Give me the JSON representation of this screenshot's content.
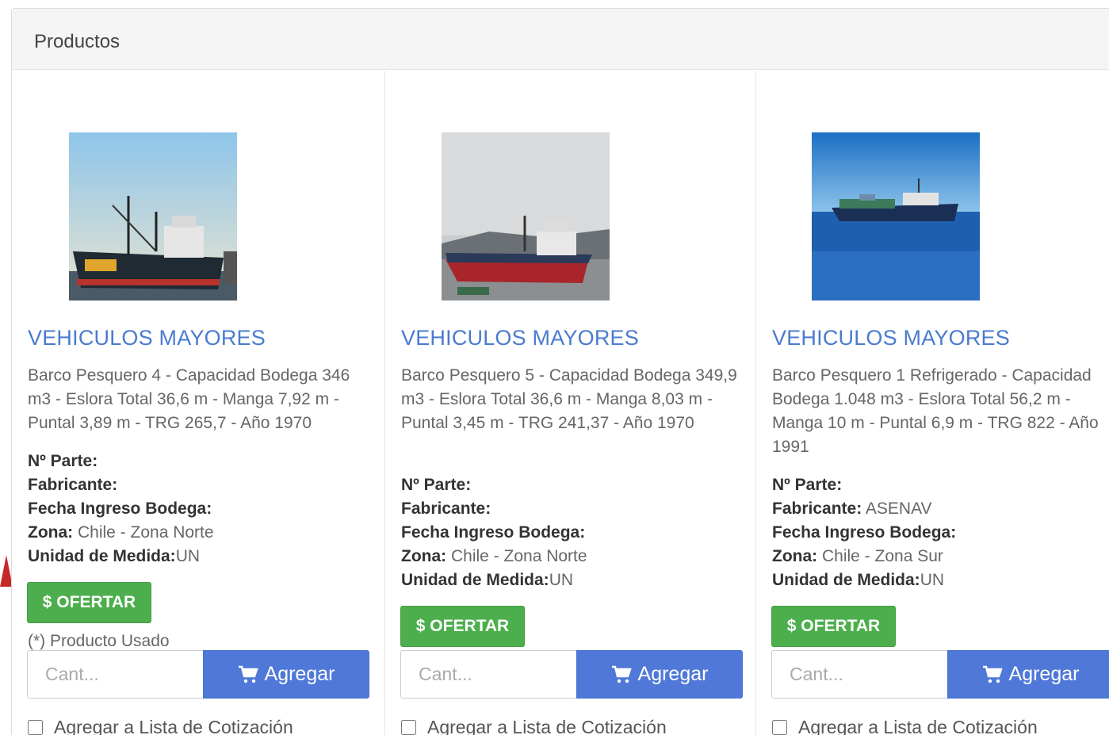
{
  "panel": {
    "title": "Productos"
  },
  "products": [
    {
      "category": "VEHICULOS MAYORES",
      "description": "Barco Pesquero 4 - Capacidad Bodega 346 m3 - Eslora Total 36,6 m - Manga 7,92 m - Puntal 3,89 m - TRG 265,7 - Año 1970",
      "part_label": "Nº Parte:",
      "part_value": "",
      "maker_label": "Fabricante:",
      "maker_value": "",
      "date_label": "Fecha Ingreso Bodega:",
      "date_value": "",
      "zone_label": "Zona:",
      "zone_value": " Chile - Zona Norte",
      "unit_label": "Unidad de Medida:",
      "unit_value": "UN",
      "offer_label": "$ OFERTAR",
      "used_note": "(*) Producto Usado",
      "qty_placeholder": "Cant...",
      "add_label": "Agregar",
      "quote_label": "Agregar a Lista de Cotización"
    },
    {
      "category": "VEHICULOS MAYORES",
      "description": "Barco Pesquero 5 - Capacidad Bodega 349,9 m3 - Eslora Total 36,6 m - Manga 8,03 m - Puntal 3,45 m - TRG 241,37 - Año 1970",
      "part_label": "Nº Parte:",
      "part_value": "",
      "maker_label": "Fabricante:",
      "maker_value": "",
      "date_label": "Fecha Ingreso Bodega:",
      "date_value": "",
      "zone_label": "Zona:",
      "zone_value": " Chile - Zona Norte",
      "unit_label": "Unidad de Medida:",
      "unit_value": "UN",
      "offer_label": "$ OFERTAR",
      "qty_placeholder": "Cant...",
      "add_label": "Agregar",
      "quote_label": "Agregar a Lista de Cotización"
    },
    {
      "category": "VEHICULOS MAYORES",
      "description": "Barco Pesquero 1 Refrigerado - Capacidad Bodega 1.048 m3 - Eslora Total 56,2 m - Manga 10 m - Puntal 6,9 m - TRG 822 - Año 1991",
      "part_label": "Nº Parte:",
      "part_value": "",
      "maker_label": "Fabricante:",
      "maker_value": " ASENAV",
      "date_label": "Fecha Ingreso Bodega:",
      "date_value": "",
      "zone_label": "Zona:",
      "zone_value": " Chile - Zona Sur",
      "unit_label": "Unidad de Medida:",
      "unit_value": "UN",
      "offer_label": "$ OFERTAR",
      "qty_placeholder": "Cant...",
      "add_label": "Agregar",
      "quote_label": "Agregar a Lista de Cotización"
    }
  ],
  "colors": {
    "link_blue": "#4a7bd0",
    "offer_green": "#4cae4c",
    "add_blue": "#4f78d8",
    "annotation_red": "#c62828"
  },
  "icons": {
    "cart": "shopping-cart-icon",
    "annotation": "red-arrow-annotation"
  }
}
